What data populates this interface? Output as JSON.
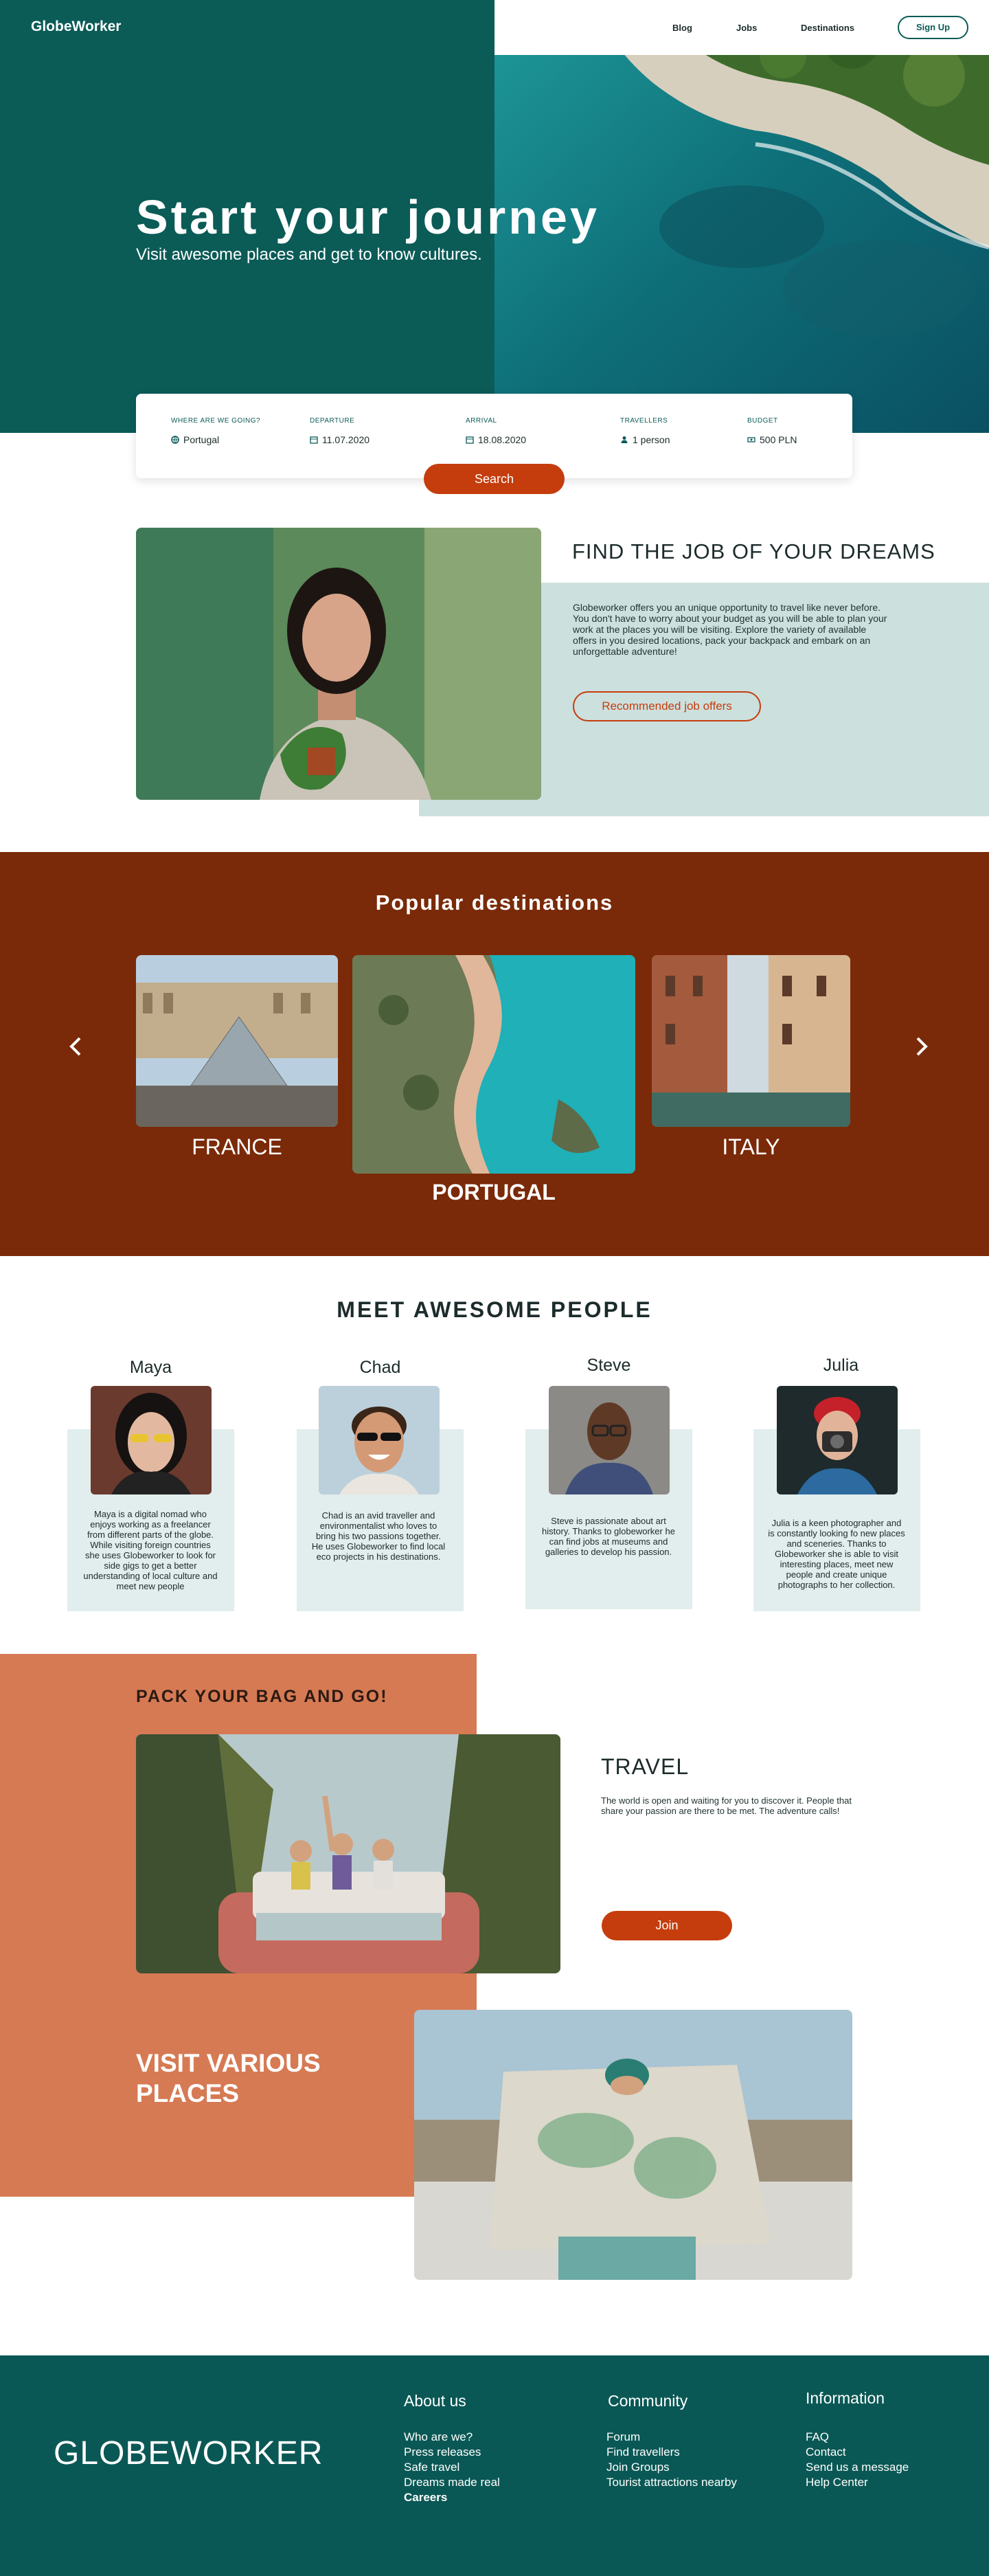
{
  "brand": "GlobeWorker",
  "nav": {
    "blog": "Blog",
    "jobs": "Jobs",
    "destinations": "Destinations",
    "signup": "Sign Up"
  },
  "hero": {
    "title": "Start your journey",
    "subtitle": "Visit awesome places and get to know cultures."
  },
  "search": {
    "where_label": "WHERE ARE WE GOING?",
    "where_value": "Portugal",
    "departure_label": "DEPARTURE",
    "departure_value": "11.07.2020",
    "arrival_label": "ARRIVAL",
    "arrival_value": "18.08.2020",
    "travellers_label": "TRAVELLERS",
    "travellers_value": "1 person",
    "budget_label": "BUDGET",
    "budget_value": "500 PLN",
    "button": "Search"
  },
  "jobs": {
    "title": "FIND THE JOB OF YOUR DREAMS",
    "text": "Globeworker offers you an unique opportunity to travel like never before. You don't have to worry about your budget as you will be able to plan your work at the places you will be visiting. Explore the variety of available offers in you desired locations, pack your backpack and embark on an unforgettable adventure!",
    "button": "Recommended job offers"
  },
  "destinations": {
    "title": "Popular destinations",
    "items": [
      {
        "name": "FRANCE"
      },
      {
        "name": "PORTUGAL"
      },
      {
        "name": "ITALY"
      }
    ]
  },
  "people": {
    "title": "MEET AWESOME PEOPLE",
    "items": [
      {
        "name": "Maya",
        "desc": "Maya is a digital nomad who enjoys working as a freelancer from different parts of the globe. While visiting foreign countries she uses Globeworker to look for side gigs to get a better understanding of local culture and meet new people"
      },
      {
        "name": "Chad",
        "desc": "Chad is an avid traveller and environmentalist who loves to bring his two passions together. He uses Globeworker to find local eco projects in his destinations."
      },
      {
        "name": "Steve",
        "desc": "Steve is passionate about art history. Thanks to globeworker he can find jobs at museums and galleries to develop his passion."
      },
      {
        "name": "Julia",
        "desc": "Julia is a keen photographer and is constantly looking fo new places and sceneries. Thanks to Globeworker she is able to visit interesting places, meet new people and create unique photographs to her collection."
      }
    ]
  },
  "pack": {
    "title": "PACK YOUR BAG AND GO!",
    "travel_title": "TRAVEL",
    "travel_text": "The world is open and waiting for you to discover it. People that share your passion are there to be met. The adventure calls!",
    "join": "Join",
    "visit_title": "VISIT VARIOUS PLACES"
  },
  "footer": {
    "logo": "GLOBEWORKER",
    "about": {
      "title": "About us",
      "links": [
        "Who are we?",
        "Press releases",
        "Safe travel",
        "Dreams made real",
        "Careers"
      ]
    },
    "community": {
      "title": "Community",
      "links": [
        "Forum",
        "Find travellers",
        "Join Groups",
        "Tourist attractions nearby"
      ]
    },
    "information": {
      "title": "Information",
      "links": [
        "FAQ",
        "Contact",
        "Send us a message",
        "Help Center"
      ]
    }
  },
  "colors": {
    "teal": "#0b5b57",
    "rust": "#7a2a08",
    "orange": "#c53d0d",
    "terracotta": "#d67a54",
    "mint": "#cce0de"
  }
}
